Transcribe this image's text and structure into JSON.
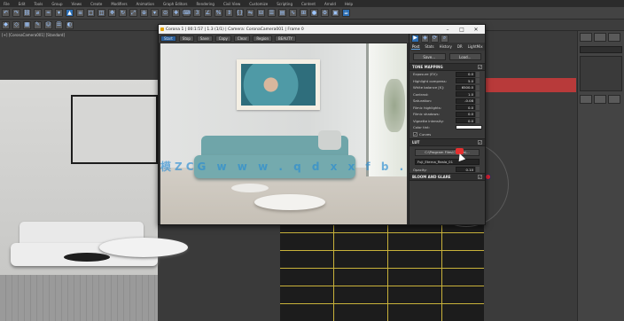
{
  "menubar": {
    "items": [
      "File",
      "Edit",
      "Tools",
      "Group",
      "Views",
      "Create",
      "Modifiers",
      "Animation",
      "Graph Editors",
      "Rendering",
      "Civil View",
      "Customize",
      "Scripting",
      "Content",
      "Arnold",
      "Help"
    ]
  },
  "viewport_left": {
    "label": "[+] [CoronaCamera001] [Standard]"
  },
  "frame_buffer": {
    "title": "Corona 1 | 00:1:57 | 1.3 (1/1) | Camera: CoronaCamera001 | Frame 0",
    "window_controls": [
      "–",
      "□",
      "✕"
    ],
    "toolbar": {
      "buttons": [
        "Start",
        "Stop",
        "Save",
        "Copy",
        "Clear",
        "Region",
        "BEAUTY"
      ]
    },
    "watermark": "模ZCG w w w . q d x x f b . c n"
  },
  "post_panel": {
    "tabs": [
      "Post",
      "Stats",
      "History",
      "DR",
      "LightMix"
    ],
    "active_tab": "Post",
    "save_label": "Save...",
    "load_label": "Load...",
    "tone_mapping": {
      "header": "TONE MAPPING",
      "rows": [
        {
          "label": "Exposure (EV):",
          "value": "0.0"
        },
        {
          "label": "Highlight compress:",
          "value": "5.0"
        },
        {
          "label": "White balance [K]:",
          "value": "6500.0"
        },
        {
          "label": "Contrast:",
          "value": "1.0"
        },
        {
          "label": "Saturation:",
          "value": "-0.08"
        },
        {
          "label": "Filmic highlights:",
          "value": "0.0"
        },
        {
          "label": "Filmic shadows:",
          "value": "0.0"
        },
        {
          "label": "Vignette intensity:",
          "value": "0.0"
        },
        {
          "label": "Color tint:",
          "value": ""
        }
      ],
      "curves_label": "Curves"
    },
    "lut": {
      "header": "LUT",
      "path_button": "C:\\Program Files\\Corona\\...",
      "lut_select": "Fuji_Eterna_Reala_01",
      "opacity_label": "Opacity:",
      "opacity_value": "0.10"
    },
    "bloom": {
      "header": "BLOOM AND GLARE"
    }
  },
  "colors": {
    "accent": "#2b5f9a",
    "brick_mortar": "#c9b23a",
    "watermark": "#288cd2"
  }
}
